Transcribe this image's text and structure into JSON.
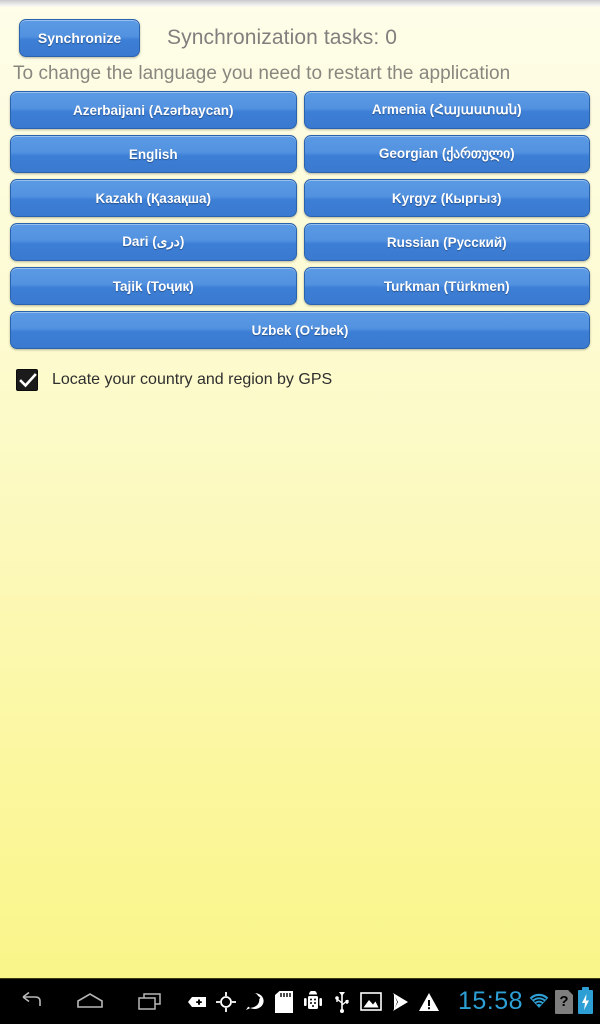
{
  "app": {
    "background_top": "#fefee9",
    "background_bottom": "#faf58a",
    "accent": "#3d7fd6"
  },
  "header": {
    "sync_button_label": "Synchronize",
    "sync_status": "Synchronization tasks: 0"
  },
  "notice": {
    "restart_text": "To change the language you need to restart the application"
  },
  "languages": [
    {
      "label": "Azerbaijani (Azərbaycan)",
      "name": "azerbaijani",
      "full": false
    },
    {
      "label": "Armenia (Հայաստան)",
      "name": "armenia",
      "full": false
    },
    {
      "label": "English",
      "name": "english",
      "full": false
    },
    {
      "label": "Georgian (ქართული)",
      "name": "georgian",
      "full": false
    },
    {
      "label": "Kazakh (Қазақша)",
      "name": "kazakh",
      "full": false
    },
    {
      "label": "Kyrgyz (Кыргыз)",
      "name": "kyrgyz",
      "full": false
    },
    {
      "label": "Dari (دری)",
      "name": "dari",
      "full": false
    },
    {
      "label": "Russian (Русский)",
      "name": "russian",
      "full": false
    },
    {
      "label": "Tajik (Тоҷик)",
      "name": "tajik",
      "full": false
    },
    {
      "label": "Turkman (Türkmen)",
      "name": "turkman",
      "full": false
    },
    {
      "label": "Uzbek (O‘zbek)",
      "name": "uzbek",
      "full": true
    }
  ],
  "gps": {
    "label": "Locate your country and region by GPS",
    "checked": true
  },
  "systembar": {
    "nav": [
      {
        "name": "back-icon"
      },
      {
        "name": "home-icon"
      },
      {
        "name": "recents-icon"
      }
    ],
    "notifications": [
      {
        "name": "add-badge-icon"
      },
      {
        "name": "gps-crosshair-icon"
      },
      {
        "name": "check-bubble-icon"
      },
      {
        "name": "sd-card-icon"
      },
      {
        "name": "android-robot-icon"
      },
      {
        "name": "usb-icon"
      },
      {
        "name": "photo-icon"
      },
      {
        "name": "play-store-icon"
      },
      {
        "name": "warning-icon"
      }
    ],
    "clock": "15:58",
    "wifi_icon": "wifi-icon",
    "sdcard_status": "?",
    "battery_icon": "battery-charging-icon",
    "status_color": "#2d9fd4"
  }
}
